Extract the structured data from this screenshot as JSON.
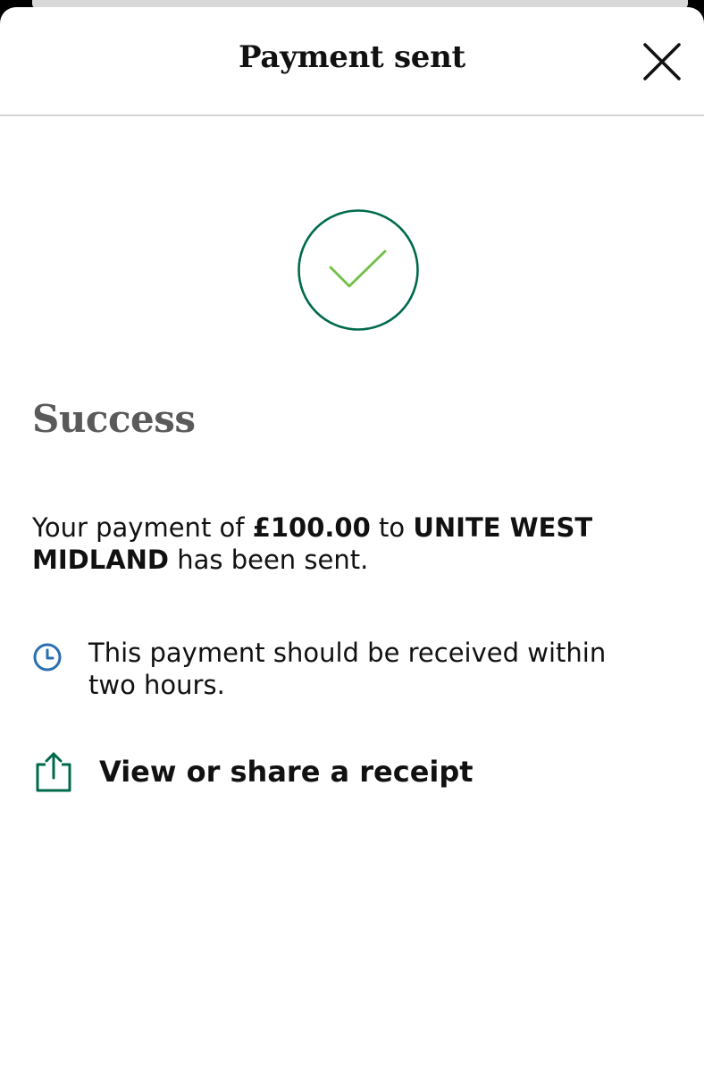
{
  "header": {
    "title": "Payment sent",
    "close_icon": "close-icon"
  },
  "status": {
    "icon": "checkmark-circle-icon",
    "title": "Success"
  },
  "message": {
    "prefix": "Your payment of ",
    "amount": "£100.00",
    "middle": " to ",
    "payee": "UNITE WEST MIDLAND",
    "suffix": " has been sent."
  },
  "info": {
    "icon": "clock-icon",
    "text": "This payment should be received within two hours."
  },
  "receipt": {
    "icon": "share-icon",
    "label": "View or share a receipt"
  },
  "colors": {
    "brand_green": "#006a4d",
    "check_green": "#6fbf44",
    "clock_blue": "#2a6fb0",
    "heading_grey": "#5a5a5a"
  }
}
